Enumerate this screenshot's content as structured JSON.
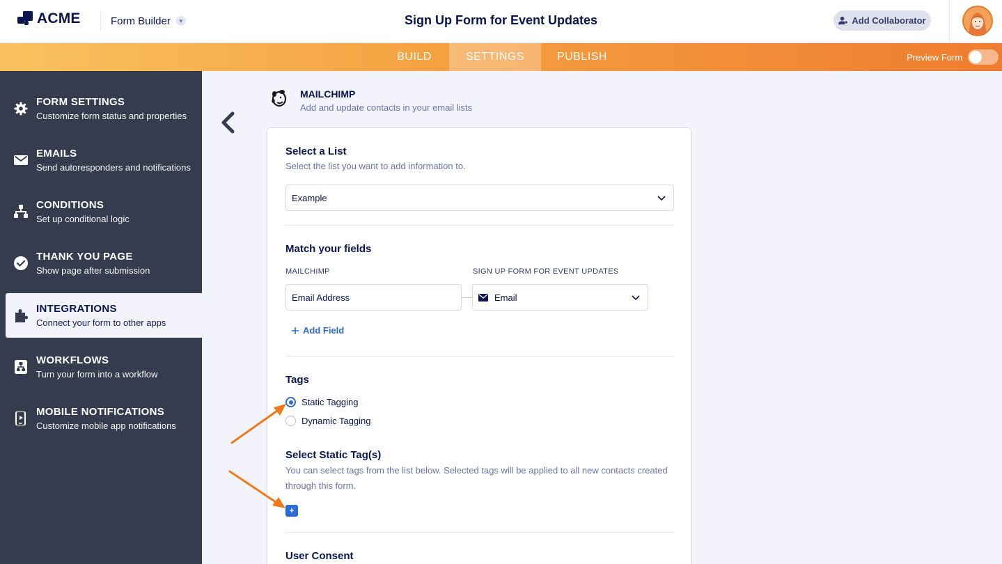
{
  "header": {
    "logo_text": "ACME",
    "product_menu": "Form Builder",
    "page_title": "Sign Up Form for Event Updates",
    "collaborator_button": "Add Collaborator"
  },
  "nav": {
    "tabs": [
      {
        "label": "BUILD",
        "active": false
      },
      {
        "label": "SETTINGS",
        "active": true
      },
      {
        "label": "PUBLISH",
        "active": false
      }
    ],
    "preview_label": "Preview Form",
    "preview_on": false
  },
  "sidebar": {
    "items": [
      {
        "title": "FORM SETTINGS",
        "subtitle": "Customize form status and properties",
        "icon": "gear-icon"
      },
      {
        "title": "EMAILS",
        "subtitle": "Send autoresponders and notifications",
        "icon": "envelope-icon"
      },
      {
        "title": "CONDITIONS",
        "subtitle": "Set up conditional logic",
        "icon": "hierarchy-icon"
      },
      {
        "title": "THANK YOU PAGE",
        "subtitle": "Show page after submission",
        "icon": "check-circle-icon"
      },
      {
        "title": "INTEGRATIONS",
        "subtitle": "Connect your form to other apps",
        "icon": "puzzle-icon",
        "active": true
      },
      {
        "title": "WORKFLOWS",
        "subtitle": "Turn your form into a workflow",
        "icon": "workflow-icon"
      },
      {
        "title": "MOBILE NOTIFICATIONS",
        "subtitle": "Customize mobile app notifications",
        "icon": "mobile-icon"
      }
    ]
  },
  "integration": {
    "name": "MAILCHIMP",
    "description": "Add and update contacts in your email lists"
  },
  "list_section": {
    "title": "Select a List",
    "description": "Select the list you want to add information to.",
    "selected": "Example"
  },
  "fields_section": {
    "title": "Match your fields",
    "left_column": "MAILCHIMP",
    "right_column": "SIGN UP FORM FOR EVENT UPDATES",
    "left_value": "Email Address",
    "right_value": "Email",
    "add_field": "Add Field"
  },
  "tags_section": {
    "title": "Tags",
    "options": [
      {
        "label": "Static Tagging",
        "checked": true
      },
      {
        "label": "Dynamic Tagging",
        "checked": false
      }
    ]
  },
  "static_tags": {
    "title": "Select Static Tag(s)",
    "description": "You can select tags from the list below. Selected tags will be applied to all new contacts created through this form.",
    "add_label": "+"
  },
  "consent_section": {
    "title": "User Consent"
  },
  "colors": {
    "accent_blue": "#2b6bd6",
    "sidebar_bg": "#343c4e",
    "nav_gradient_start": "#f9c25e",
    "nav_gradient_end": "#ef7c30",
    "annotation_arrow": "#f07a1a"
  }
}
